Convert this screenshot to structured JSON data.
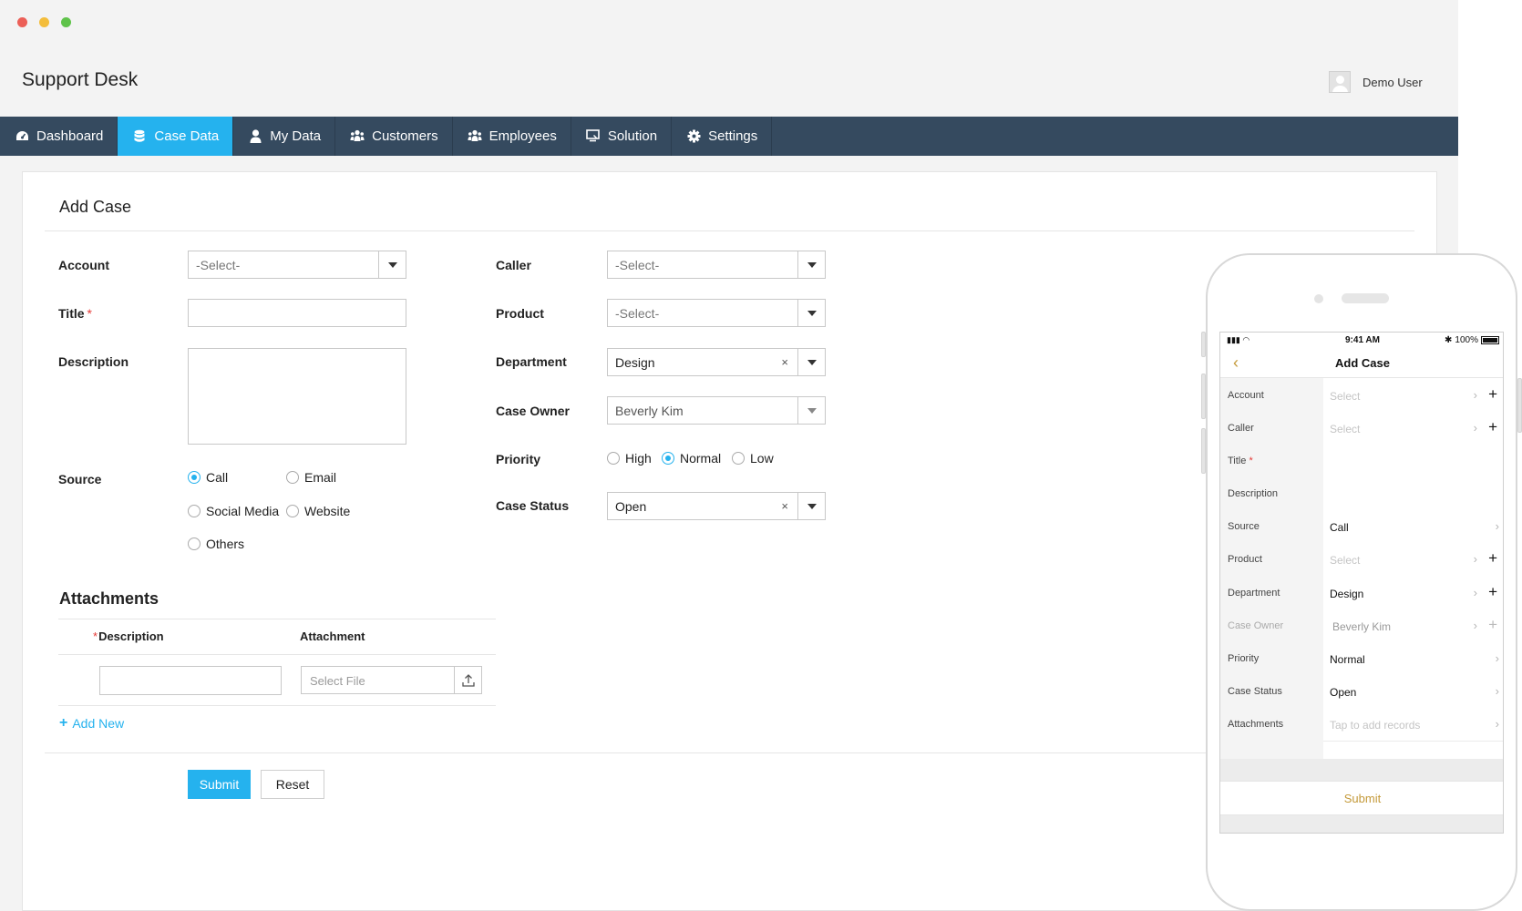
{
  "window": {
    "traffic_colors": [
      "#ec5f57",
      "#f3bd3b",
      "#5fc34a"
    ]
  },
  "header": {
    "title": "Support Desk",
    "user_name": "Demo User"
  },
  "nav": {
    "items": [
      {
        "label": "Dashboard",
        "icon": "dashboard-icon",
        "active": false
      },
      {
        "label": "Case Data",
        "icon": "database-icon",
        "active": true
      },
      {
        "label": "My Data",
        "icon": "user-icon",
        "active": false
      },
      {
        "label": "Customers",
        "icon": "users-icon",
        "active": false
      },
      {
        "label": "Employees",
        "icon": "team-icon",
        "active": false
      },
      {
        "label": "Solution",
        "icon": "solution-icon",
        "active": false
      },
      {
        "label": "Settings",
        "icon": "gear-icon",
        "active": false
      }
    ],
    "bg_color": "#354a5f",
    "active_color": "#25b2ee"
  },
  "form": {
    "title": "Add Case",
    "account": {
      "label": "Account",
      "value": "-Select-"
    },
    "title_field": {
      "label": "Title",
      "required_mark": "*",
      "value": ""
    },
    "description": {
      "label": "Description",
      "value": ""
    },
    "source": {
      "label": "Source",
      "options": [
        "Call",
        "Email",
        "Social Media",
        "Website",
        "Others"
      ],
      "selected": "Call"
    },
    "caller": {
      "label": "Caller",
      "value": "-Select-"
    },
    "product": {
      "label": "Product",
      "value": "-Select-"
    },
    "department": {
      "label": "Department",
      "value": "Design",
      "clear": "×"
    },
    "case_owner": {
      "label": "Case Owner",
      "value": "Beverly Kim"
    },
    "priority": {
      "label": "Priority",
      "options": [
        "High",
        "Normal",
        "Low"
      ],
      "selected": "Normal"
    },
    "case_status": {
      "label": "Case Status",
      "value": "Open",
      "clear": "×"
    }
  },
  "attachments": {
    "title": "Attachments",
    "col_description": "Description",
    "col_required_mark": "*",
    "col_attachment": "Attachment",
    "file_placeholder": "Select File",
    "add_new": "Add New"
  },
  "buttons": {
    "submit": "Submit",
    "reset": "Reset"
  },
  "mobile": {
    "time": "9:41 AM",
    "battery": "100%",
    "title": "Add Case",
    "rows": [
      {
        "label": "Account",
        "value": "Select",
        "placeholder": true,
        "chevron": true,
        "plus": true
      },
      {
        "label": "Caller",
        "value": "Select",
        "placeholder": true,
        "chevron": true,
        "plus": true
      },
      {
        "label": "Title",
        "required": "*",
        "value": "",
        "placeholder": false,
        "chevron": false,
        "plus": false
      },
      {
        "label": "Description",
        "value": "",
        "placeholder": false,
        "chevron": false,
        "plus": false
      },
      {
        "label": "Source",
        "value": "Call",
        "placeholder": false,
        "chevron": true,
        "plus": false
      },
      {
        "label": "Product",
        "value": "Select",
        "placeholder": true,
        "chevron": true,
        "plus": true
      },
      {
        "label": "Department",
        "value": "Design",
        "placeholder": false,
        "chevron": true,
        "plus": true
      },
      {
        "label": "Case Owner",
        "value": "Beverly Kim",
        "placeholder": false,
        "disabled": true,
        "chevron": true,
        "plus": true
      },
      {
        "label": "Priority",
        "value": "Normal",
        "placeholder": false,
        "chevron": true,
        "plus": false
      },
      {
        "label": "Case Status",
        "value": "Open",
        "placeholder": false,
        "chevron": true,
        "plus": false
      },
      {
        "label": "Attachments",
        "value": "Tap to add records",
        "placeholder": true,
        "chevron": true,
        "plus": false
      }
    ],
    "submit": "Submit",
    "accent_color": "#c49a3a"
  }
}
